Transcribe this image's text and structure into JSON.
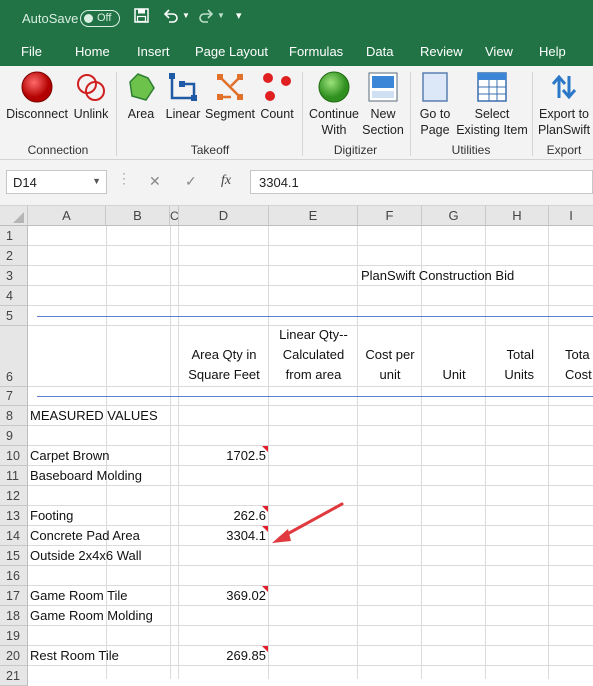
{
  "titlebar": {
    "autosave_label": "AutoSave",
    "autosave_state": "Off"
  },
  "menu": {
    "tabs": [
      "File",
      "Home",
      "Insert",
      "Page Layout",
      "Formulas",
      "Data",
      "Review",
      "View",
      "Help"
    ]
  },
  "ribbon": {
    "groups": {
      "connection": "Connection",
      "takeoff": "Takeoff",
      "digitizer": "Digitizer",
      "utilities": "Utilities",
      "export": "Export"
    },
    "buttons": {
      "disconnect": "Disconnect",
      "unlink": "Unlink",
      "area": "Area",
      "linear": "Linear",
      "segment": "Segment",
      "count": "Count",
      "continue_1": "Continue",
      "continue_2": "With",
      "newsection_1": "New",
      "newsection_2": "Section",
      "gotopage_1": "Go to",
      "gotopage_2": "Page",
      "select_1": "Select",
      "select_2": "Existing Item",
      "export_1": "Export to",
      "export_2": "PlanSwift"
    },
    "colors": {
      "accent": "#217346",
      "ribbon_bg": "#f3f3f3"
    }
  },
  "formula_bar": {
    "name_box": "D14",
    "cancel": "✕",
    "enter": "✓",
    "fx": "fx",
    "value": "3304.1"
  },
  "sheet": {
    "columns": [
      "A",
      "B",
      "C",
      "D",
      "E",
      "F",
      "G",
      "H",
      "I"
    ],
    "rows": [
      "1",
      "2",
      "3",
      "4",
      "5",
      "6",
      "7",
      "8",
      "9",
      "10",
      "11",
      "12",
      "13",
      "14",
      "15",
      "16",
      "17",
      "18",
      "19",
      "20",
      "21"
    ],
    "title": "PlanSwift Construction Bid",
    "headers": {
      "d_1": "Area Qty in",
      "d_2": "Square Feet",
      "e_1": "Linear Qty--",
      "e_2": "Calculated",
      "e_3": "from area",
      "f_1": "Cost per",
      "f_2": "unit",
      "g_1": "Unit",
      "h_1": "Total",
      "h_2": "Units",
      "i_1": "Tota",
      "i_2": "Cost"
    },
    "section_label": "MEASURED VALUES",
    "items": {
      "r10": {
        "name": "Carpet Brown",
        "qty": "1702.5"
      },
      "r11": {
        "name": "Baseboard Molding",
        "qty": ""
      },
      "r13": {
        "name": "Footing",
        "qty": "262.6"
      },
      "r14": {
        "name": "Concrete Pad Area",
        "qty": "3304.1"
      },
      "r15": {
        "name": "Outside 2x4x6 Wall",
        "qty": ""
      },
      "r17": {
        "name": "Game Room Tile",
        "qty": "369.02"
      },
      "r18": {
        "name": "Game Room Molding",
        "qty": ""
      },
      "r20": {
        "name": "Rest Room Tile",
        "qty": "269.85"
      }
    },
    "selected_cell": "D14"
  }
}
